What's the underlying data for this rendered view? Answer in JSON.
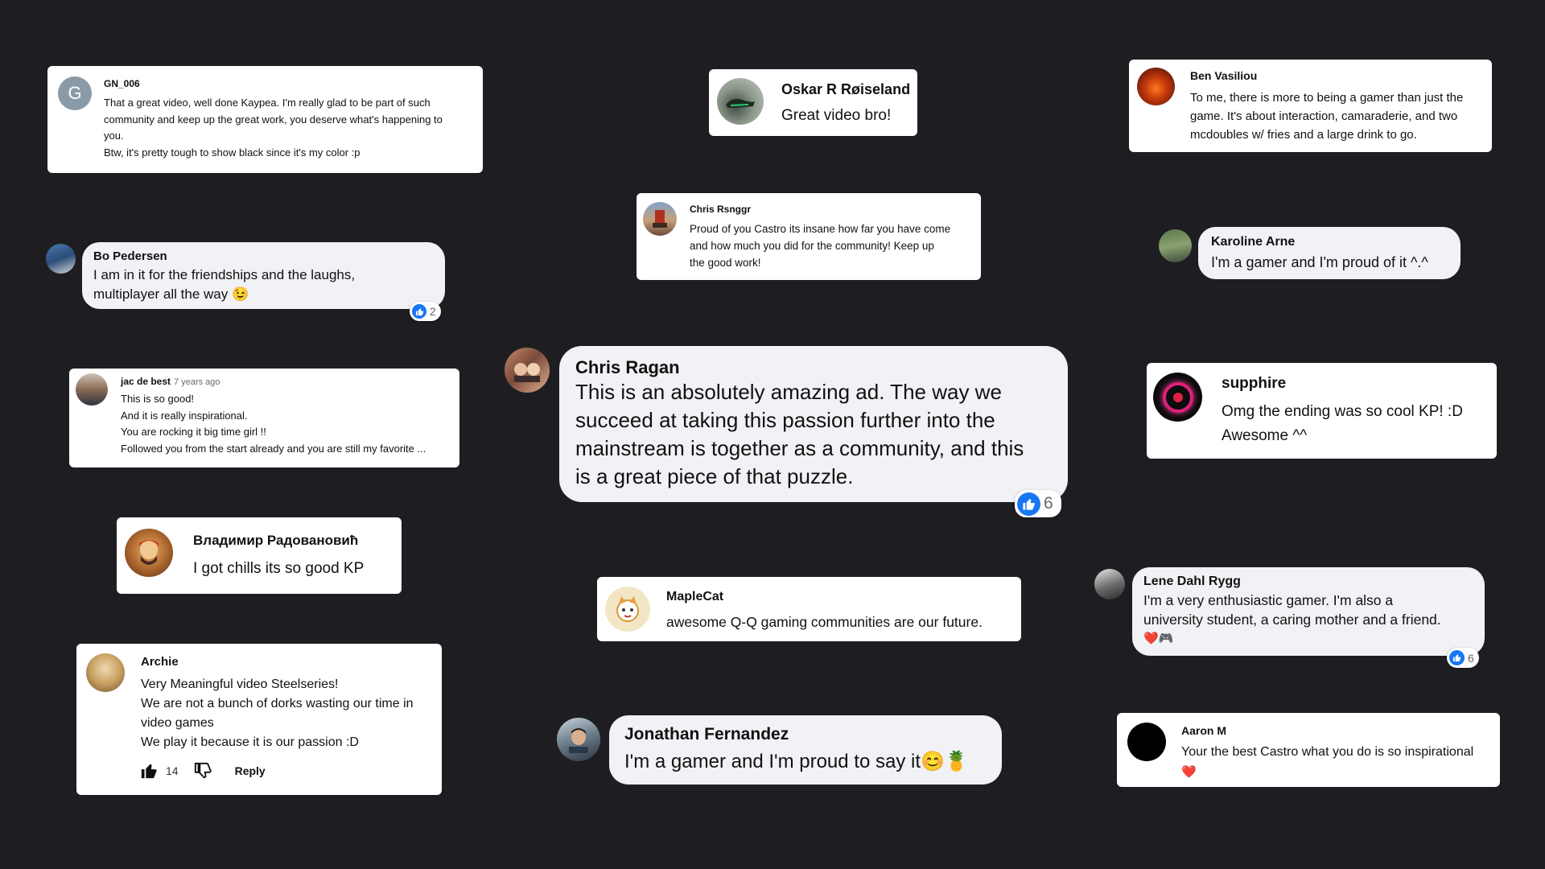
{
  "comments": {
    "gn006": {
      "avatar_letter": "G",
      "author": "GN_006",
      "lines": [
        "That a great video, well done Kaypea. I'm really glad to be part of such",
        "community and keep up the great work, you deserve what's happening to",
        "you.",
        "Btw, it's pretty tough to show black since it's my color :p"
      ]
    },
    "oskar": {
      "author": "Oskar R Røiseland",
      "text": "Great video bro!"
    },
    "ben": {
      "author": "Ben Vasiliou",
      "lines": [
        "To me, there is more to being a gamer than just the",
        "game. It's about interaction,  camaraderie, and two",
        "mcdoubles w/ fries and a large drink to go."
      ]
    },
    "chris_r": {
      "author": "Chris Rsnggr",
      "lines": [
        "Proud of you Castro its insane how far you have come",
        "and how much you did for the community! Keep up",
        "the good work!"
      ]
    },
    "bo": {
      "author": "Bo Pedersen",
      "lines": [
        "I am in it for the friendships and the laughs,",
        "multiplayer all the way 😉"
      ],
      "likes": "2"
    },
    "karoline": {
      "author": "Karoline Arne",
      "text": "I'm a gamer and I'm proud of it ^.^"
    },
    "jac": {
      "author": "jac de best",
      "time": "7 years ago",
      "lines": [
        "This is so good!",
        "And it is really inspirational.",
        "You are rocking it big time girl !!",
        "Followed you from the start already and you are still my favorite ..."
      ]
    },
    "chris_ragan": {
      "author": "Chris Ragan",
      "lines": [
        "This is an absolutely amazing ad. The way we",
        "succeed at taking this passion further into the",
        "mainstream is together as a community, and this",
        "is a great piece of that puzzle."
      ],
      "likes": "6"
    },
    "supphire": {
      "author": "supphire",
      "lines": [
        "Omg the ending was so cool KP! :D",
        "Awesome ^^"
      ]
    },
    "vladimir": {
      "author": "Владимир Радовановић",
      "text": "I got chills its so good KP"
    },
    "maplecat": {
      "author": "MapleCat",
      "text": "awesome Q-Q gaming communities are our future."
    },
    "lene": {
      "author": "Lene Dahl Rygg",
      "lines": [
        "I'm a very enthusiastic gamer. I'm also a",
        "university student, a caring mother and a friend.",
        "❤️🎮"
      ],
      "likes": "6"
    },
    "archie": {
      "author": "Archie",
      "lines": [
        "Very Meaningful video Steelseries!",
        "We are not a bunch of dorks wasting our time in",
        "video games",
        "We play it because it is our passion :D"
      ],
      "likes": "14",
      "reply_label": "Reply"
    },
    "jonathan": {
      "author": "Jonathan Fernandez",
      "text": "I'm a gamer and I'm proud to say it😊🍍"
    },
    "aaron": {
      "author": "Aaron M",
      "lines": [
        "Your the best Castro what you do is so inspirational",
        "❤️"
      ]
    }
  },
  "colors": {
    "background": "#1e1e22",
    "like_blue": "#1877f2"
  }
}
